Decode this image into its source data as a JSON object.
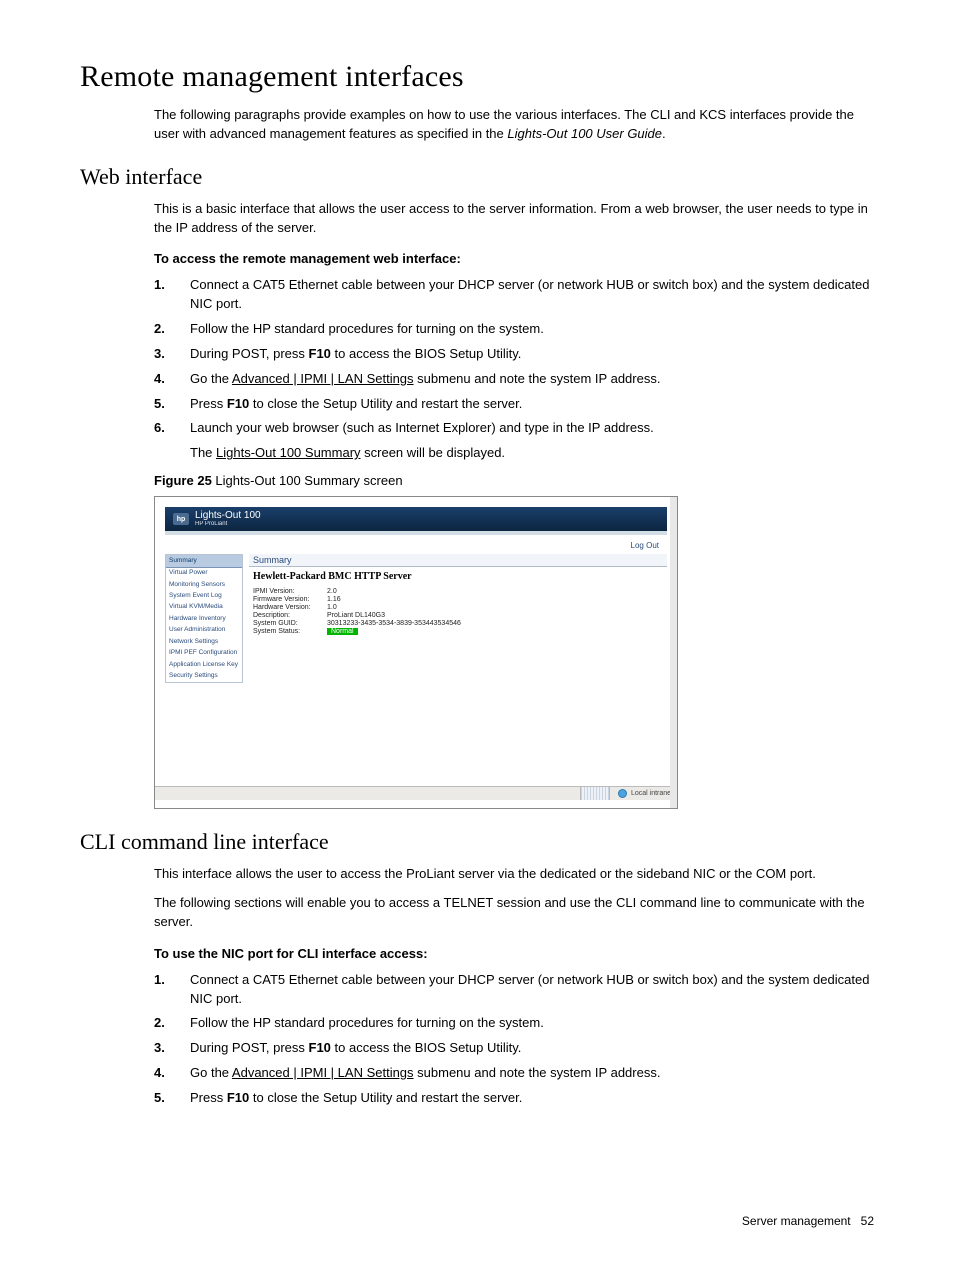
{
  "h1": "Remote management interfaces",
  "intro": [
    "The following paragraphs provide examples on how to use the various interfaces. The CLI and KCS interfaces provide the user with advanced management features as specified in the ",
    "Lights-Out 100 User Guide",
    "."
  ],
  "web": {
    "h2": "Web interface",
    "p1": "This is a basic interface that allows the user access to the server information. From a web browser, the user needs to type in the IP address of the server.",
    "bold": "To access the remote management web interface:",
    "steps": {
      "s1": {
        "n": "1.",
        "t": "Connect a CAT5 Ethernet cable between your DHCP server (or network HUB or switch box) and the system dedicated NIC port."
      },
      "s2": {
        "n": "2.",
        "t": "Follow the HP standard procedures for turning on the system."
      },
      "s3": {
        "n": "3.",
        "a": "During POST, press ",
        "b": "F10",
        "c": " to access the BIOS Setup Utility."
      },
      "s4": {
        "n": "4.",
        "a": "Go the ",
        "u": "Advanced | IPMI | LAN Settings",
        "c": " submenu and note the system IP address."
      },
      "s5": {
        "n": "5.",
        "a": "Press ",
        "b": "F10",
        "c": " to close the Setup Utility and restart the server."
      },
      "s6": {
        "n": "6.",
        "a": "Launch your web browser (such as Internet Explorer) and type in the IP address.",
        "b": "The ",
        "u": "Lights-Out 100 Summary",
        "c": " screen will be displayed."
      }
    },
    "fig": {
      "label": "Figure 25",
      "text": " Lights-Out 100 Summary screen"
    }
  },
  "sshot": {
    "hp": "hp",
    "title": "Lights-Out 100",
    "sub": "HP ProLiant",
    "logout": "Log Out",
    "sidebar": [
      "Summary",
      "Virtual Power",
      "Monitoring Sensors",
      "System Event Log",
      "Virtual KVM/Media",
      "Hardware Inventory",
      "User Administration",
      "Network Settings",
      "IPMI PEF Configuration",
      "Application License Key",
      "Security Settings"
    ],
    "boxtitle": "Summary",
    "server": "Hewlett-Packard BMC HTTP Server",
    "rows": {
      "r1": {
        "k": "IPMI Version:",
        "v": "2.0"
      },
      "r2": {
        "k": "Firmware Version:",
        "v": "1.16"
      },
      "r3": {
        "k": "Hardware Version:",
        "v": "1.0"
      },
      "r4": {
        "k": "Description:",
        "v": "ProLiant DL140G3"
      },
      "r5": {
        "k": "System GUID:",
        "v": "30313233-3435-3534-3839-353443534546"
      },
      "r6": {
        "k": "System Status:",
        "v": "Normal"
      }
    },
    "status": "Local intranet"
  },
  "cli": {
    "h2": "CLI command line interface",
    "p1": "This interface allows the user to access the ProLiant server via the dedicated or the sideband NIC or the COM port.",
    "p2": "The following sections will enable you to access a TELNET session and use the CLI command line to communicate with the server.",
    "bold": "To use the NIC port for CLI interface access:",
    "steps": {
      "s1": {
        "n": "1.",
        "t": "Connect a CAT5 Ethernet cable between your DHCP server (or network HUB or switch box) and the system dedicated NIC port."
      },
      "s2": {
        "n": "2.",
        "t": "Follow the HP standard procedures for turning on the system."
      },
      "s3": {
        "n": "3.",
        "a": "During POST, press ",
        "b": "F10",
        "c": " to access the BIOS Setup Utility."
      },
      "s4": {
        "n": "4.",
        "a": "Go the ",
        "u": "Advanced | IPMI | LAN Settings",
        "c": " submenu and note the system IP address."
      },
      "s5": {
        "n": "5.",
        "a": "Press ",
        "b": "F10",
        "c": " to close the Setup Utility and restart the server."
      }
    }
  },
  "footer": {
    "section": "Server management",
    "page": "52"
  }
}
